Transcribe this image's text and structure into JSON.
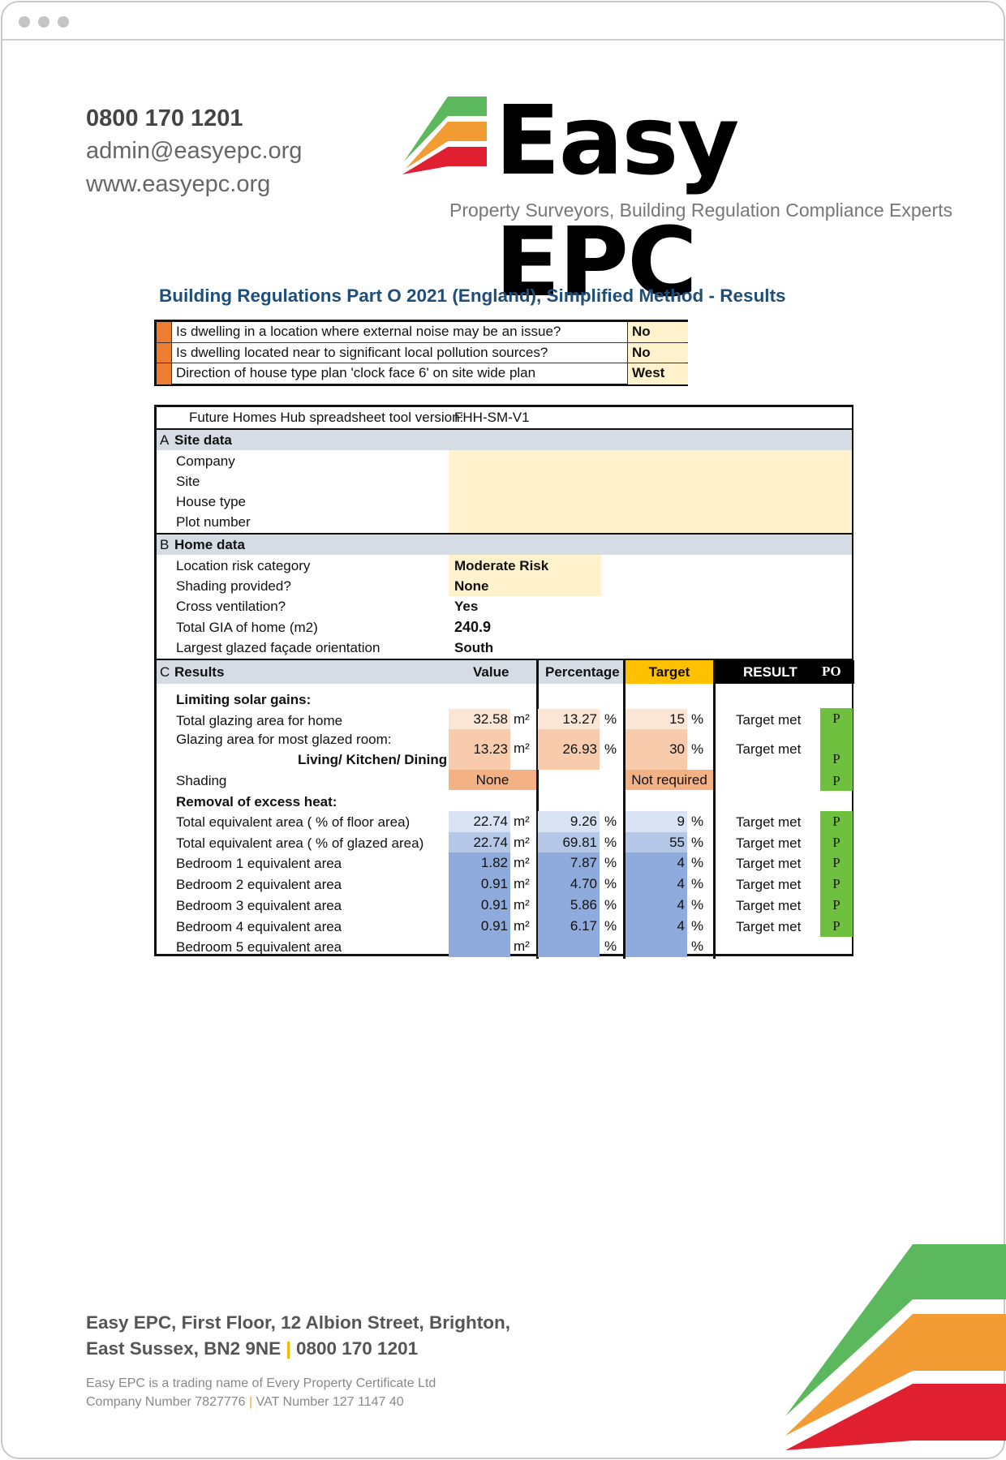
{
  "window": {
    "controls": [
      "close",
      "minimize",
      "maximize"
    ]
  },
  "header": {
    "phone": "0800 170 1201",
    "email": "admin@easyepc.org",
    "website": "www.easyepc.org",
    "logo_text": "Easy EPC",
    "tagline": "Property Surveyors, Building Regulation Compliance Experts",
    "brand_colors": {
      "green": "#5cb85c",
      "orange": "#f39c33",
      "red": "#e02030"
    }
  },
  "document": {
    "title": "Building Regulations Part O 2021 (England), Simplified Method - Results",
    "questions": [
      {
        "question": "Is dwelling in a location where external noise may be an issue?",
        "answer": "No"
      },
      {
        "question": "Is dwelling located near to significant local pollution sources?",
        "answer": "No"
      },
      {
        "question": "Direction of house type plan 'clock face 6' on site wide plan",
        "answer": "West"
      }
    ],
    "tool_version_label": "Future Homes Hub spreadsheet tool version:",
    "tool_version": "FHH-SM-V1",
    "section_a": {
      "letter": "A",
      "title": "Site data",
      "fields": [
        {
          "label": "Company",
          "value": ""
        },
        {
          "label": "Site",
          "value": ""
        },
        {
          "label": "House type",
          "value": ""
        },
        {
          "label": "Plot number",
          "value": ""
        }
      ]
    },
    "section_b": {
      "letter": "B",
      "title": "Home data",
      "fields": [
        {
          "label": "Location risk category",
          "value": "Moderate Risk"
        },
        {
          "label": "Shading provided?",
          "value": "None"
        },
        {
          "label": "Cross ventilation?",
          "value": "Yes"
        },
        {
          "label": "Total GIA of home (m2)",
          "value": "240.9"
        },
        {
          "label": "Largest glazed façade orientation",
          "value": "South"
        }
      ]
    },
    "section_c": {
      "letter": "C",
      "title": "Results",
      "columns": {
        "value": "Value",
        "percentage": "Percentage",
        "target": "Target",
        "result": "RESULT",
        "po": "PO"
      },
      "solar_heading": "Limiting solar gains:",
      "solar_rows": [
        {
          "label": "Total glazing area for home",
          "value": "32.58",
          "value_unit": "m²",
          "pct": "13.27",
          "pct_unit": "%",
          "target": "15",
          "target_unit": "%",
          "result": "Target met",
          "po": "P"
        },
        {
          "label": "Glazing area for most glazed room:",
          "sublabel": "Living/ Kitchen/ Dining",
          "value": "13.23",
          "value_unit": "m²",
          "pct": "26.93",
          "pct_unit": "%",
          "target": "30",
          "target_unit": "%",
          "result": "Target met",
          "po": "P"
        },
        {
          "label": "Shading",
          "value": "None",
          "target": "Not required",
          "po": "P"
        }
      ],
      "heat_heading": "Removal of excess heat:",
      "heat_rows": [
        {
          "label": "Total equivalent area ( % of floor area)",
          "value": "22.74",
          "value_unit": "m²",
          "pct": "9.26",
          "pct_unit": "%",
          "target": "9",
          "target_unit": "%",
          "result": "Target met",
          "po": "P"
        },
        {
          "label": "Total equivalent area ( % of glazed area)",
          "value": "22.74",
          "value_unit": "m²",
          "pct": "69.81",
          "pct_unit": "%",
          "target": "55",
          "target_unit": "%",
          "result": "Target met",
          "po": "P"
        },
        {
          "label": "Bedroom 1 equivalent area",
          "value": "1.82",
          "value_unit": "m²",
          "pct": "7.87",
          "pct_unit": "%",
          "target": "4",
          "target_unit": "%",
          "result": "Target met",
          "po": "P"
        },
        {
          "label": "Bedroom 2 equivalent area",
          "value": "0.91",
          "value_unit": "m²",
          "pct": "4.70",
          "pct_unit": "%",
          "target": "4",
          "target_unit": "%",
          "result": "Target met",
          "po": "P"
        },
        {
          "label": "Bedroom 3 equivalent area",
          "value": "0.91",
          "value_unit": "m²",
          "pct": "5.86",
          "pct_unit": "%",
          "target": "4",
          "target_unit": "%",
          "result": "Target met",
          "po": "P"
        },
        {
          "label": "Bedroom 4 equivalent area",
          "value": "0.91",
          "value_unit": "m²",
          "pct": "6.17",
          "pct_unit": "%",
          "target": "4",
          "target_unit": "%",
          "result": "Target met",
          "po": "P"
        },
        {
          "label": "Bedroom 5 equivalent area",
          "value": "",
          "value_unit": "m²",
          "pct": "",
          "pct_unit": "%",
          "target": "",
          "target_unit": "%",
          "result": "",
          "po": ""
        }
      ]
    }
  },
  "footer": {
    "address_line1": "Easy EPC, First Floor, 12 Albion Street, Brighton,",
    "address_line2": "East Sussex, BN2 9NE",
    "separator": "|",
    "phone": "0800 170 1201",
    "trading_name": "Easy EPC is a trading name of Every Property Certificate Ltd",
    "company_number": "Company Number 7827776",
    "vat_number": "VAT Number 127 1147 40"
  }
}
